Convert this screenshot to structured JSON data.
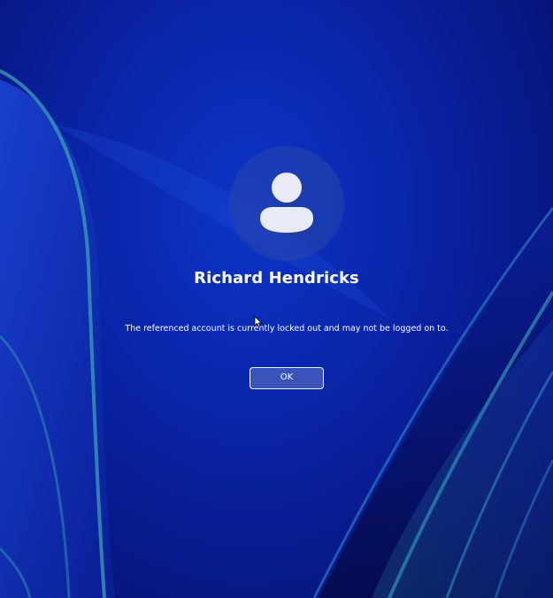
{
  "lock_screen": {
    "user_name": "Richard Hendricks",
    "message": "The referenced account is currently locked out and may not be logged on to.",
    "ok_label": "OK"
  },
  "icons": {
    "avatar": "user-silhouette-icon",
    "pointer": "mouse-cursor-icon"
  },
  "colors": {
    "background": "#0a24a6",
    "accent_ribbon": "#2f8fb0",
    "text": "#ffffff",
    "avatar_glyph": "#e8eaf6"
  }
}
